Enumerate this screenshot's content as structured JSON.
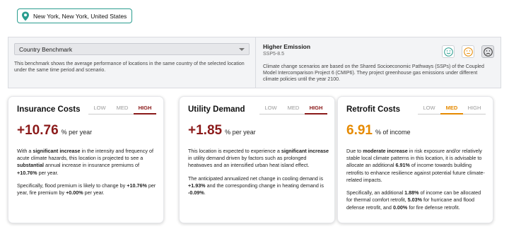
{
  "location": {
    "text": "New York, New York, United States",
    "icon": "map-pin-icon",
    "accent": "#2a9d8f"
  },
  "benchmark": {
    "selected": "Country Benchmark",
    "description": "This benchmark shows the average performance of locations in the same country of the selected location under the same time period and scenario."
  },
  "scenario": {
    "title": "Higher Emission",
    "subtitle": "SSP5-8.5",
    "description": "Climate change scenarios are based on the Shared Socioeconomic Pathways (SSPs) of the Coupled Model Intercomparison Project 6 (CMIP6). They project greenhouse gas emissions under different climate policies until the year 2100.",
    "faces": [
      {
        "icon": "smile-face-icon",
        "color": "#2a9d8f",
        "active": false
      },
      {
        "icon": "neutral-face-icon",
        "color": "#e68a00",
        "active": false
      },
      {
        "icon": "frown-face-icon",
        "color": "#333333",
        "active": true
      }
    ]
  },
  "cards": {
    "insurance": {
      "title": "Insurance Costs",
      "tabs": [
        "LOW",
        "MED",
        "HIGH"
      ],
      "selected_tab": "HIGH",
      "value": "+10.76",
      "unit": "% per year",
      "p1_a": "With a ",
      "p1_b": "significant increase",
      "p1_c": " in the intensity and frequency of acute climate hazards, this location is projected to see a ",
      "p1_d": "substantial",
      "p1_e": " annual increase in insurance premiums of ",
      "p1_f": "+10.76%",
      "p1_g": " per year.",
      "p2_a": "Specifically, flood premium is likely to change by ",
      "p2_b": "+10.76%",
      "p2_c": " per year, fire premium by ",
      "p2_d": "+0.00%",
      "p2_e": " per year.",
      "color": "#8b1a1a"
    },
    "utility": {
      "title": "Utility Demand",
      "tabs": [
        "LOW",
        "MED",
        "HIGH"
      ],
      "selected_tab": "HIGH",
      "value": "+1.85",
      "unit": "% per year",
      "p1_a": "This location is expected to experience a ",
      "p1_b": "significant increase",
      "p1_c": " in utility demand driven by factors such as prolonged heatwaves and an intensified urban heat island effect.",
      "p2_a": "The anticipated annualized net change in cooling demand is ",
      "p2_b": "+1.93%",
      "p2_c": " and the corresponding change in heating demand is ",
      "p2_d": "-0.09%",
      "p2_e": ".",
      "color": "#8b1a1a"
    },
    "retrofit": {
      "title": "Retrofit Costs",
      "tabs": [
        "LOW",
        "MED",
        "HIGH"
      ],
      "selected_tab": "MED",
      "value": "6.91",
      "unit": "% of income",
      "p1_a": "Due to ",
      "p1_b": "moderate increase",
      "p1_c": " in risk exposure and/or relatively stable local climate patterns in this location, it is advisable to allocate an additional ",
      "p1_d": "6.91%",
      "p1_e": " of income towards building retrofits to enhance resilience against potential future climate-related impacts.",
      "p2_a": "Specifically, an additional ",
      "p2_b": "1.88%",
      "p2_c": " of income can be allocated for thermal comfort retrofit, ",
      "p2_d": "5.03%",
      "p2_e": " for hurricane and flood defense retrofit, and ",
      "p2_f": "0.00%",
      "p2_g": " for fire defense retrofit.",
      "color": "#e68a00"
    }
  }
}
